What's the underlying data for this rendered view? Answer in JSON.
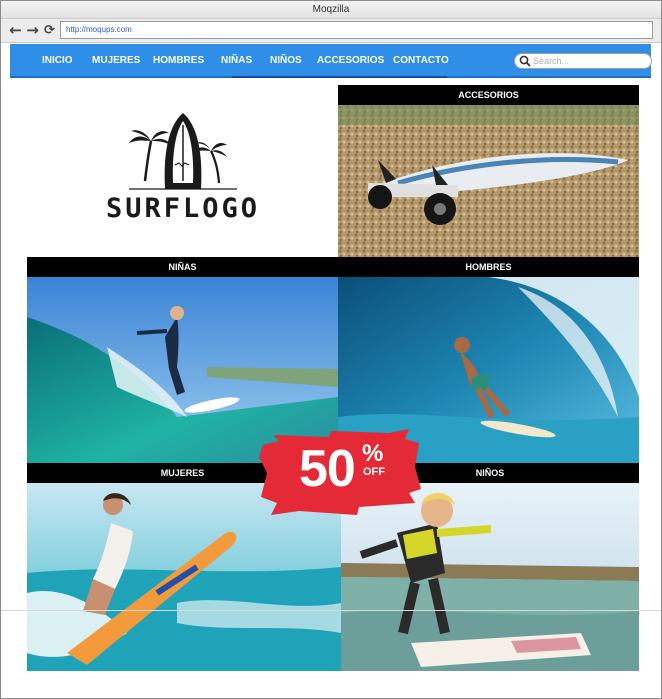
{
  "window": {
    "title": "Moqzilla"
  },
  "browser": {
    "back_icon": "arrow-left-icon",
    "forward_icon": "arrow-right-icon",
    "reload_icon": "reload-icon",
    "url": "http://moqups.com"
  },
  "nav": {
    "items": [
      "INICIO",
      "MUJERES",
      "HOMBRES",
      "NIÑAS",
      "NIÑOS",
      "ACCESORIOS",
      "CONTACTO"
    ],
    "search_placeholder": "Search...",
    "color": "#2e8ee8"
  },
  "logo": {
    "text": "SURFLOGO"
  },
  "categories": {
    "accesorios": "ACCESORIOS",
    "ninas": "NIÑAS",
    "hombres": "HOMBRES",
    "mujeres": "MUJERES",
    "ninos": "NIÑOS"
  },
  "promo": {
    "amount": "50",
    "percent": "%",
    "off": "OFF",
    "color": "#e32a36"
  }
}
